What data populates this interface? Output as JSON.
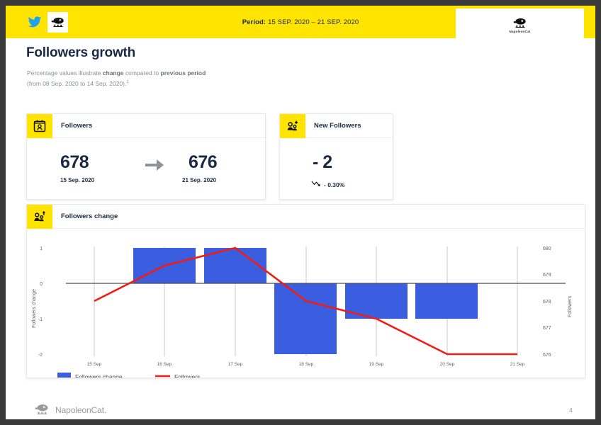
{
  "header": {
    "network_icon": "twitter-icon",
    "avatar_icon": "profile-avatar-napoleoncat",
    "period_label": "Period:",
    "period_value": "15 SEP. 2020 – 21 SEP. 2020",
    "brand_name": "NapoleonCat"
  },
  "page": {
    "title": "Followers growth",
    "subtitle_line1_a": "Percentage values illustrate ",
    "subtitle_line1_b": "change",
    "subtitle_line1_c": " compared to ",
    "subtitle_line1_d": "previous period",
    "subtitle_line2": "(from 08 Sep. 2020 to 14 Sep. 2020).",
    "subtitle_footnote": "1",
    "page_number": "4",
    "footer_brand": "NapoleonCat."
  },
  "cards": {
    "followers": {
      "icon": "followers-badge-icon",
      "title": "Followers",
      "start_value": "678",
      "start_date": "15 Sep. 2020",
      "end_value": "676",
      "end_date": "21 Sep. 2020",
      "arrow_icon": "arrow-right-icon"
    },
    "new_followers": {
      "icon": "new-followers-icon",
      "title": "New Followers",
      "value": "- 2",
      "trend_icon": "trend-down-icon",
      "percent": "- 0.30%"
    }
  },
  "chart_card": {
    "icon": "followers-change-icon",
    "title": "Followers change"
  },
  "colors": {
    "brand_yellow": "#ffe400",
    "bar_blue": "#3b5ee0",
    "line_red": "#f01c14",
    "text_dark": "#1b2a44",
    "text_muted": "#8a8f98"
  },
  "chart_data": {
    "type": "bar",
    "title": "Followers change",
    "categories": [
      "15 Sep",
      "16 Sep",
      "17 Sep",
      "18 Sep",
      "19 Sep",
      "20 Sep",
      "21 Sep"
    ],
    "series": [
      {
        "name": "Followers change",
        "type": "bar",
        "color": "#3b5ee0",
        "axis": "left",
        "values": [
          0,
          1,
          1,
          -2,
          -1,
          -1,
          0
        ]
      },
      {
        "name": "Followers",
        "type": "line",
        "color": "#f01c14",
        "axis": "right",
        "values": [
          678,
          679,
          680,
          678,
          677,
          676,
          676
        ]
      }
    ],
    "xlabel": "",
    "ylabel_left": "Followers change",
    "ylabel_right": "Followers",
    "ylim_left": [
      -2,
      1
    ],
    "yticks_left": [
      "1",
      "0",
      "-1",
      "-2"
    ],
    "ylim_right": [
      676,
      680
    ],
    "yticks_right": [
      "680",
      "679",
      "678",
      "677",
      "676"
    ],
    "grid": true,
    "legend_position": "bottom-left",
    "legend": [
      {
        "label": "Followers change",
        "marker": "square",
        "color": "#3b5ee0"
      },
      {
        "label": "Followers",
        "marker": "line",
        "color": "#f01c14"
      }
    ]
  }
}
